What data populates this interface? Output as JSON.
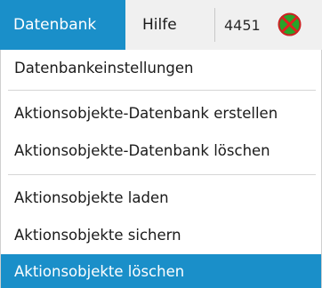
{
  "menubar": {
    "datenbank_label": "Datenbank",
    "hilfe_label": "Hilfe",
    "counter": "4451",
    "status_icon": "green-disk-red-x-icon"
  },
  "menu": {
    "items": [
      {
        "label": "Datenbankeinstellungen"
      },
      {
        "label": "Aktionsobjekte-Datenbank erstellen"
      },
      {
        "label": "Aktionsobjekte-Datenbank löschen"
      },
      {
        "label": "Aktionsobjekte laden"
      },
      {
        "label": "Aktionsobjekte sichern"
      },
      {
        "label": "Aktionsobjekte löschen",
        "highlighted": true
      }
    ]
  },
  "colors": {
    "accent": "#1a8fc9",
    "menubar_bg": "#f0f0f0",
    "icon_green": "#29a329",
    "icon_red": "#e02020"
  }
}
